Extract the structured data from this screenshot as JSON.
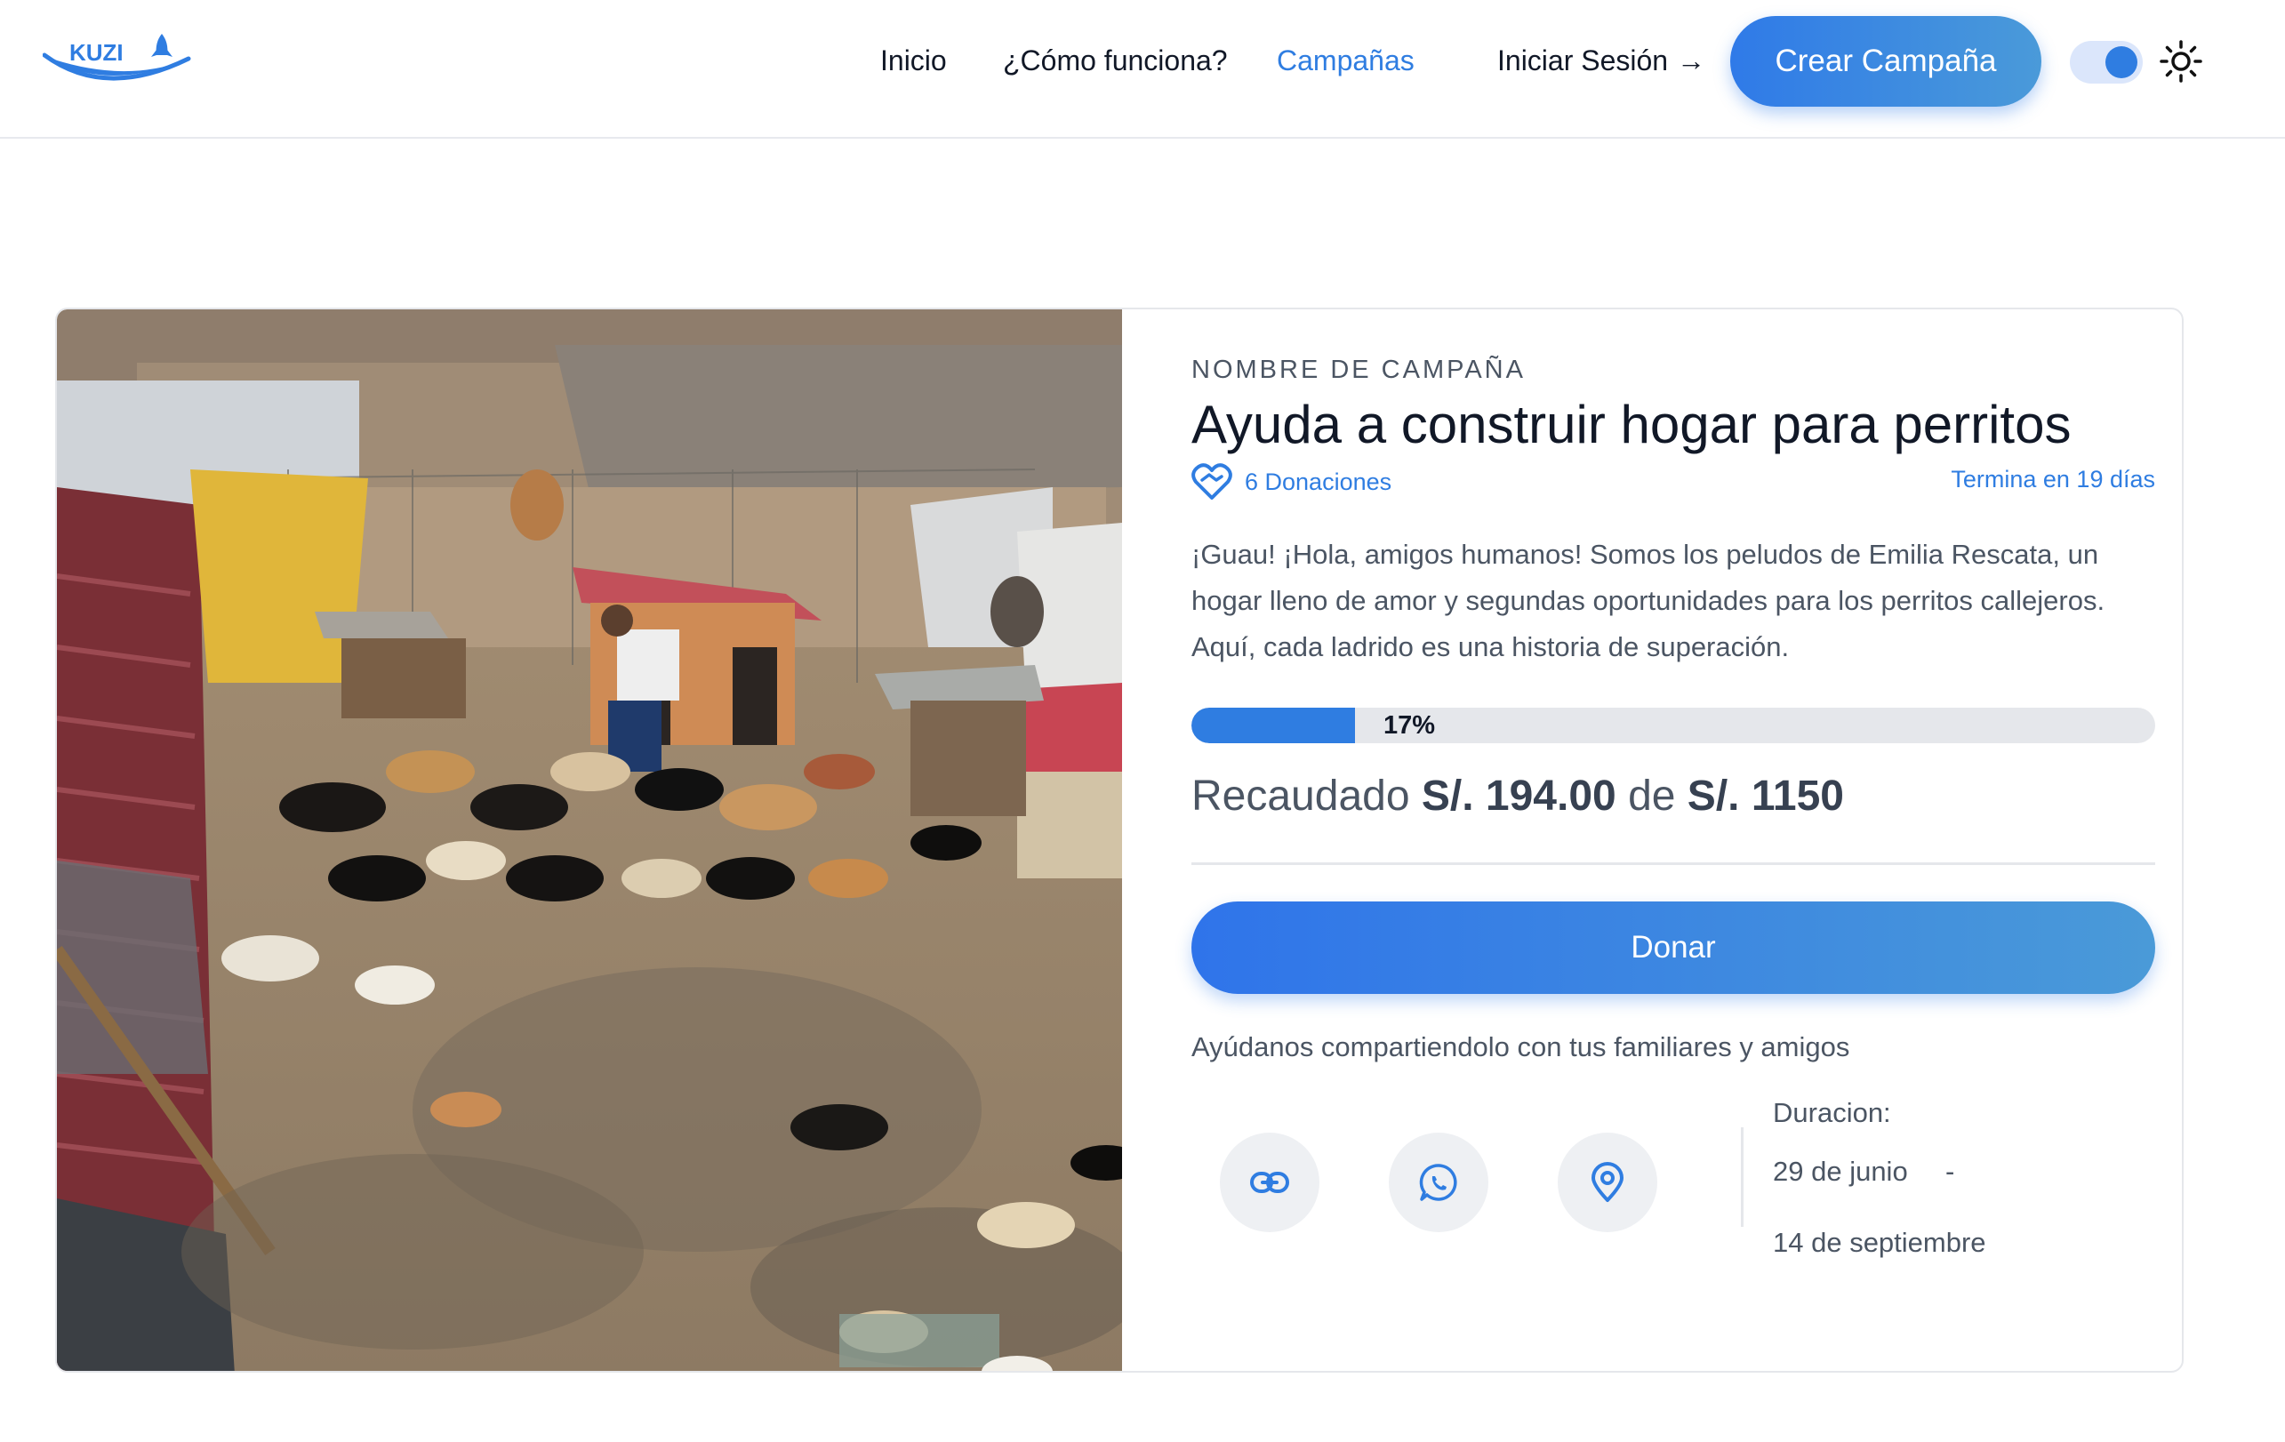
{
  "brand": {
    "logo_text": "KUZI",
    "accent": "#2f7de1"
  },
  "nav": {
    "items": [
      {
        "label": "Inicio"
      },
      {
        "label": "¿Cómo funciona?"
      },
      {
        "label": "Campañas",
        "active": true
      }
    ],
    "login_label": "Iniciar Sesión",
    "login_arrow": "→",
    "create_label": "Crear Campaña",
    "theme_toggle_on": true,
    "theme_icon": "sun-icon"
  },
  "campaign": {
    "label": "NOMBRE DE CAMPAÑA",
    "title": "Ayuda a construir hogar para perritos",
    "donations": "6 Donaciones",
    "ends": "Termina en 19 días",
    "description": "¡Guau! ¡Hola, amigos humanos! Somos los peludos de Emilia Rescata, un hogar lleno de amor y segundas oportunidades para los perritos callejeros. Aquí, cada ladrido es una historia de superación.",
    "progress_percent": 17,
    "progress_label": "17%",
    "raised_prefix": "Recaudado",
    "raised_amount": "S/. 194.00",
    "raised_connector": "de",
    "goal_amount": "S/. 1150",
    "donate_label": "Donar",
    "share_text": "Ayúdanos compartiendolo con tus familiares y amigos",
    "share_icons": [
      "link-icon",
      "whatsapp-icon",
      "location-pin-icon"
    ],
    "duration_label": "Duracion:",
    "start_date": "29 de junio",
    "date_separator": "-",
    "end_date": "14 de septiembre"
  }
}
